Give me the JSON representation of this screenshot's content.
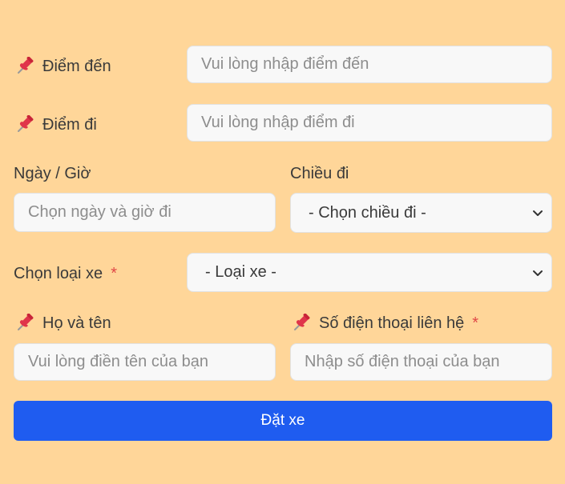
{
  "form": {
    "destination": {
      "label": "Điểm đến",
      "placeholder": "Vui lòng nhập điểm đến",
      "icon": "pushpin-icon"
    },
    "origin": {
      "label": "Điểm đi",
      "placeholder": "Vui lòng nhập điểm đi",
      "icon": "pushpin-icon"
    },
    "datetime": {
      "label": "Ngày / Giờ",
      "placeholder": "Chọn ngày và giờ đi"
    },
    "direction": {
      "label": "Chiều đi",
      "selected": "- Chọn chiều đi -"
    },
    "vehicle": {
      "label": "Chọn loại xe",
      "required_mark": "*",
      "selected": "- Loại xe -"
    },
    "name": {
      "label": "Họ và tên",
      "placeholder": "Vui lòng điền tên của bạn",
      "icon": "pushpin-icon"
    },
    "phone": {
      "label": "Số điện thoại liên hệ",
      "required_mark": "*",
      "placeholder": "Nhập số điện thoại của bạn",
      "icon": "pushpin-icon"
    },
    "submit_label": "Đặt xe"
  },
  "colors": {
    "background": "#ffd699",
    "button": "#1f5cf0",
    "required": "#e04848",
    "pin": "#e0344a"
  }
}
